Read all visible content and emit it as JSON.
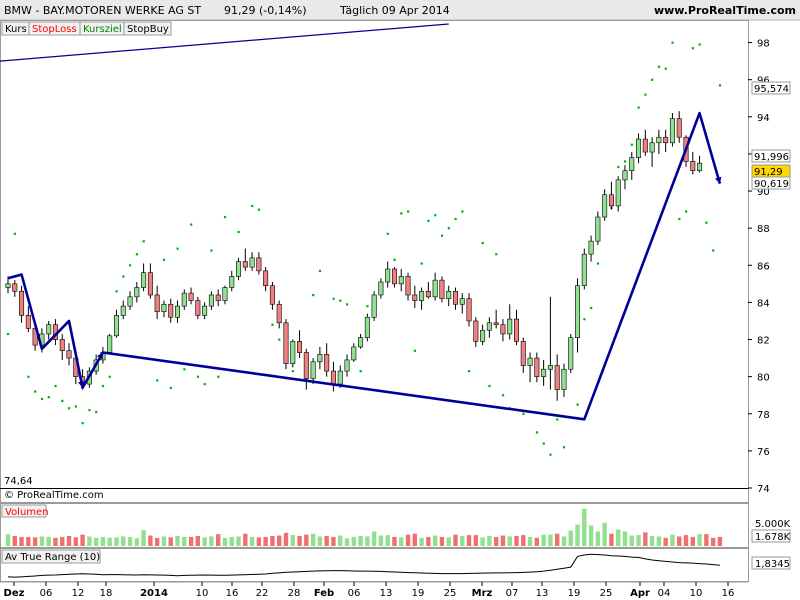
{
  "header": {
    "symbol": "BMW - BAY.MOTOREN WERKE AG ST",
    "quote": "91,29 (-0,14%)",
    "period": "Täglich  09 Apr 2014",
    "site": "www.ProRealTime.com"
  },
  "tabs": [
    {
      "label": "Kurs",
      "color": "#000000"
    },
    {
      "label": "StopLoss",
      "color": "#ff0000"
    },
    {
      "label": "Kursziel",
      "color": "#008000"
    },
    {
      "label": "StopBuy",
      "color": "#000000"
    }
  ],
  "copyright": "© ProRealTime.com",
  "colors": {
    "up": "#8fe08f",
    "down": "#f08080",
    "stop_dots": "#00b000",
    "trend_line": "#000099",
    "volume_up": "#90e090",
    "volume_down": "#f07070",
    "atr_line": "#000000"
  },
  "chart_data": {
    "type": "candlestick",
    "title": "BMW - BAY.MOTOREN WERKE AG ST",
    "ylim": [
      74,
      99
    ],
    "yticks": [
      "98",
      "96",
      "94",
      "92",
      "90",
      "88",
      "86",
      "84",
      "82",
      "80",
      "78",
      "76",
      "74"
    ],
    "min_label": "74,64",
    "price_labels": {
      "last": "91,29",
      "target": "95,574",
      "upper": "91,996",
      "lower": "90,619"
    },
    "x_labels": [
      "Dez",
      "06",
      "12",
      "18",
      "2014",
      "10",
      "16",
      "22",
      "28",
      "Feb",
      "06",
      "13",
      "19",
      "25",
      "Mrz",
      "07",
      "13",
      "19",
      "25",
      "Apr",
      "04",
      "10",
      "16"
    ],
    "x_label_bold": [
      "Dez",
      "2014",
      "Feb",
      "Mrz",
      "Apr"
    ],
    "candles": [
      [
        84.8,
        85.4,
        84.5,
        85.0
      ],
      [
        85.0,
        85.2,
        84.3,
        84.6
      ],
      [
        84.6,
        84.9,
        82.9,
        83.3
      ],
      [
        83.3,
        83.8,
        82.4,
        82.6
      ],
      [
        82.6,
        82.8,
        81.4,
        81.7
      ],
      [
        81.7,
        82.6,
        81.3,
        82.3
      ],
      [
        82.3,
        83.0,
        82.0,
        82.8
      ],
      [
        82.8,
        83.1,
        81.7,
        82.0
      ],
      [
        82.0,
        82.3,
        80.9,
        81.4
      ],
      [
        81.4,
        81.8,
        80.6,
        81.0
      ],
      [
        81.0,
        81.2,
        79.6,
        80.0
      ],
      [
        80.0,
        80.4,
        79.3,
        79.6
      ],
      [
        79.6,
        80.5,
        79.4,
        80.3
      ],
      [
        80.3,
        81.2,
        80.1,
        80.9
      ],
      [
        80.9,
        81.6,
        80.7,
        81.3
      ],
      [
        81.3,
        82.3,
        81.2,
        82.2
      ],
      [
        82.2,
        83.6,
        82.1,
        83.3
      ],
      [
        83.3,
        84.1,
        83.1,
        83.8
      ],
      [
        83.8,
        84.6,
        83.6,
        84.3
      ],
      [
        84.3,
        85.1,
        84.0,
        84.8
      ],
      [
        84.8,
        86.1,
        84.6,
        85.6
      ],
      [
        85.6,
        86.1,
        84.2,
        84.4
      ],
      [
        84.4,
        84.9,
        83.1,
        83.5
      ],
      [
        83.5,
        84.1,
        83.2,
        83.9
      ],
      [
        83.9,
        84.2,
        82.9,
        83.2
      ],
      [
        83.2,
        84.1,
        82.9,
        83.8
      ],
      [
        83.8,
        84.7,
        83.6,
        84.5
      ],
      [
        84.5,
        84.8,
        83.9,
        84.1
      ],
      [
        84.1,
        84.3,
        83.1,
        83.3
      ],
      [
        83.3,
        84.0,
        83.1,
        83.8
      ],
      [
        83.8,
        84.6,
        83.6,
        84.4
      ],
      [
        84.4,
        84.7,
        83.8,
        84.1
      ],
      [
        84.1,
        84.9,
        83.9,
        84.8
      ],
      [
        84.8,
        85.7,
        84.6,
        85.4
      ],
      [
        85.4,
        86.4,
        85.2,
        86.2
      ],
      [
        86.2,
        86.9,
        85.7,
        85.9
      ],
      [
        85.9,
        86.7,
        85.7,
        86.4
      ],
      [
        86.4,
        86.7,
        85.5,
        85.7
      ],
      [
        85.7,
        85.9,
        84.6,
        84.9
      ],
      [
        84.9,
        85.1,
        83.6,
        83.9
      ],
      [
        83.9,
        84.1,
        82.6,
        82.9
      ],
      [
        82.9,
        83.1,
        80.4,
        80.7
      ],
      [
        80.7,
        82.0,
        80.5,
        81.9
      ],
      [
        81.9,
        82.5,
        81.0,
        81.3
      ],
      [
        81.3,
        81.5,
        79.3,
        79.9
      ],
      [
        79.9,
        81.0,
        79.6,
        80.8
      ],
      [
        80.8,
        81.6,
        80.4,
        81.2
      ],
      [
        81.2,
        81.8,
        80.0,
        80.3
      ],
      [
        80.3,
        80.8,
        79.2,
        79.6
      ],
      [
        79.6,
        80.6,
        79.4,
        80.3
      ],
      [
        80.3,
        81.2,
        80.0,
        80.9
      ],
      [
        80.9,
        81.8,
        80.8,
        81.6
      ],
      [
        81.6,
        82.3,
        81.5,
        82.1
      ],
      [
        82.1,
        83.4,
        81.9,
        83.2
      ],
      [
        83.2,
        84.6,
        83.0,
        84.4
      ],
      [
        84.4,
        85.3,
        84.2,
        85.1
      ],
      [
        85.1,
        86.2,
        84.8,
        85.8
      ],
      [
        85.8,
        85.9,
        84.8,
        85.0
      ],
      [
        85.0,
        85.8,
        84.6,
        85.4
      ],
      [
        85.4,
        85.6,
        84.1,
        84.4
      ],
      [
        84.4,
        84.9,
        83.7,
        84.1
      ],
      [
        84.1,
        84.8,
        83.6,
        84.6
      ],
      [
        84.6,
        85.1,
        84.2,
        84.3
      ],
      [
        84.3,
        85.6,
        84.1,
        85.2
      ],
      [
        85.2,
        85.4,
        84.0,
        84.2
      ],
      [
        84.2,
        84.9,
        83.8,
        84.6
      ],
      [
        84.6,
        84.8,
        83.6,
        83.9
      ],
      [
        83.9,
        84.5,
        83.4,
        84.2
      ],
      [
        84.2,
        84.5,
        82.7,
        83.0
      ],
      [
        83.0,
        83.2,
        81.6,
        81.9
      ],
      [
        81.9,
        82.8,
        81.7,
        82.5
      ],
      [
        82.5,
        83.2,
        82.1,
        82.9
      ],
      [
        82.9,
        83.6,
        82.6,
        82.8
      ],
      [
        82.8,
        83.1,
        81.9,
        82.3
      ],
      [
        82.3,
        83.9,
        82.0,
        83.1
      ],
      [
        83.1,
        83.6,
        81.7,
        81.9
      ],
      [
        81.9,
        82.1,
        80.2,
        80.6
      ],
      [
        80.6,
        81.3,
        79.7,
        81.0
      ],
      [
        81.0,
        81.3,
        79.7,
        80.0
      ],
      [
        80.0,
        80.9,
        79.5,
        80.4
      ],
      [
        80.4,
        84.3,
        79.3,
        80.6
      ],
      [
        80.6,
        81.2,
        78.7,
        79.3
      ],
      [
        79.3,
        80.7,
        78.9,
        80.4
      ],
      [
        80.4,
        82.3,
        80.2,
        82.1
      ],
      [
        82.1,
        85.3,
        81.3,
        84.9
      ],
      [
        84.9,
        86.9,
        84.7,
        86.6
      ],
      [
        86.6,
        87.6,
        86.2,
        87.3
      ],
      [
        87.3,
        88.9,
        87.1,
        88.6
      ],
      [
        88.6,
        90.1,
        88.4,
        89.8
      ],
      [
        89.8,
        90.5,
        89.0,
        89.2
      ],
      [
        89.2,
        90.8,
        88.9,
        90.6
      ],
      [
        90.6,
        91.4,
        90.1,
        91.1
      ],
      [
        91.1,
        92.1,
        90.6,
        91.8
      ],
      [
        91.8,
        93.1,
        91.5,
        92.8
      ],
      [
        92.8,
        93.3,
        91.9,
        92.1
      ],
      [
        92.1,
        92.9,
        91.3,
        92.6
      ],
      [
        92.6,
        93.3,
        92.0,
        92.9
      ],
      [
        92.9,
        93.3,
        92.1,
        92.6
      ],
      [
        92.6,
        94.2,
        92.4,
        93.9
      ],
      [
        93.9,
        94.3,
        92.6,
        92.9
      ],
      [
        92.9,
        93.0,
        91.3,
        91.6
      ],
      [
        91.6,
        92.1,
        90.9,
        91.1
      ],
      [
        91.1,
        91.9,
        91.0,
        91.5
      ]
    ],
    "trend_points": [
      [
        0,
        85.3
      ],
      [
        2,
        85.5
      ],
      [
        5,
        81.5
      ],
      [
        9,
        83.0
      ],
      [
        11,
        79.4
      ],
      [
        14,
        81.3
      ],
      [
        85,
        77.7
      ],
      [
        102,
        94.2
      ],
      [
        105,
        90.4
      ]
    ],
    "top_line": [
      [
        0,
        97.0
      ],
      [
        65,
        99.0
      ]
    ],
    "stop_dots": [
      [
        0,
        82.3
      ],
      [
        1,
        87.7
      ],
      [
        3,
        80.0
      ],
      [
        4,
        79.2
      ],
      [
        5,
        78.8
      ],
      [
        6,
        78.9
      ],
      [
        7,
        79.5
      ],
      [
        8,
        78.7
      ],
      [
        9,
        78.3
      ],
      [
        10,
        78.4
      ],
      [
        11,
        77.5
      ],
      [
        12,
        78.2
      ],
      [
        13,
        78.1
      ],
      [
        14,
        79.5
      ],
      [
        15,
        80.0
      ],
      [
        16,
        84.6
      ],
      [
        17,
        85.4
      ],
      [
        18,
        86.0
      ],
      [
        19,
        86.6
      ],
      [
        20,
        87.3
      ],
      [
        22,
        79.8
      ],
      [
        23,
        86.3
      ],
      [
        24,
        79.4
      ],
      [
        25,
        86.9
      ],
      [
        26,
        80.4
      ],
      [
        27,
        88.2
      ],
      [
        28,
        80.0
      ],
      [
        29,
        79.6
      ],
      [
        30,
        86.8
      ],
      [
        31,
        80.0
      ],
      [
        32,
        88.6
      ],
      [
        34,
        87.8
      ],
      [
        36,
        89.2
      ],
      [
        37,
        89.0
      ],
      [
        39,
        82.8
      ],
      [
        40,
        82.0
      ],
      [
        42,
        80.3
      ],
      [
        44,
        79.9
      ],
      [
        45,
        84.4
      ],
      [
        46,
        85.7
      ],
      [
        48,
        84.2
      ],
      [
        49,
        84.1
      ],
      [
        50,
        83.9
      ],
      [
        51,
        81.1
      ],
      [
        52,
        80.3
      ],
      [
        53,
        83.8
      ],
      [
        56,
        87.7
      ],
      [
        57,
        86.3
      ],
      [
        58,
        88.8
      ],
      [
        59,
        88.9
      ],
      [
        60,
        81.4
      ],
      [
        61,
        86.1
      ],
      [
        62,
        88.4
      ],
      [
        63,
        88.7
      ],
      [
        64,
        87.6
      ],
      [
        65,
        88.0
      ],
      [
        66,
        88.5
      ],
      [
        67,
        88.9
      ],
      [
        68,
        80.3
      ],
      [
        70,
        87.2
      ],
      [
        71,
        79.5
      ],
      [
        72,
        86.6
      ],
      [
        73,
        79.0
      ],
      [
        74,
        78.3
      ],
      [
        76,
        78.0
      ],
      [
        78,
        77.0
      ],
      [
        79,
        76.4
      ],
      [
        80,
        75.8
      ],
      [
        81,
        77.7
      ],
      [
        82,
        76.2
      ],
      [
        84,
        78.5
      ],
      [
        85,
        83.1
      ],
      [
        86,
        83.7
      ],
      [
        87,
        86.1
      ],
      [
        89,
        89.1
      ],
      [
        90,
        91.3
      ],
      [
        91,
        91.6
      ],
      [
        92,
        92.5
      ],
      [
        93,
        94.5
      ],
      [
        94,
        95.2
      ],
      [
        95,
        96.0
      ],
      [
        96,
        96.7
      ],
      [
        97,
        96.6
      ],
      [
        98,
        98.0
      ],
      [
        99,
        88.5
      ],
      [
        100,
        88.9
      ],
      [
        101,
        97.7
      ],
      [
        102,
        97.9
      ],
      [
        103,
        88.3
      ],
      [
        104,
        86.8
      ],
      [
        105,
        95.7
      ]
    ],
    "volume": {
      "label": "Volumen",
      "ticks": [
        "5.000K",
        "1.678K"
      ],
      "values": [
        2.6,
        2.2,
        2.0,
        2.0,
        1.9,
        2.1,
        2.0,
        1.8,
        2.0,
        2.2,
        1.9,
        2.5,
        2.1,
        1.8,
        2.0,
        1.8,
        1.9,
        2.1,
        2.0,
        1.7,
        3.5,
        2.3,
        1.8,
        2.1,
        1.9,
        2.2,
        2.0,
        2.0,
        2.2,
        1.9,
        2.1,
        2.6,
        1.8,
        2.0,
        2.1,
        2.7,
        2.0,
        1.9,
        2.0,
        2.2,
        2.3,
        2.9,
        2.4,
        2.2,
        2.5,
        2.7,
        2.1,
        2.2,
        2.0,
        2.3,
        1.7,
        2.0,
        2.2,
        2.1,
        3.2,
        2.3,
        2.4,
        2.0,
        1.9,
        2.5,
        2.7,
        1.8,
        2.0,
        2.3,
        2.0,
        1.9,
        2.5,
        2.2,
        2.4,
        2.4,
        1.9,
        2.2,
        2.0,
        2.3,
        2.1,
        2.2,
        2.4,
        2.0,
        1.8,
        2.5,
        2.5,
        2.7,
        2.1,
        3.4,
        4.7,
        8.2,
        4.5,
        3.2,
        5.1,
        2.7,
        3.6,
        3.2,
        2.3,
        2.4,
        3.0,
        2.2,
        2.1,
        1.8,
        2.5,
        2.1,
        2.4,
        2.0,
        2.6,
        2.6,
        1.8,
        2.0
      ],
      "ylim": [
        0,
        8.8
      ]
    },
    "atr": {
      "label": "Av True Range (10)",
      "value_label": "1,8345",
      "values": [
        1.02,
        1.0,
        1.02,
        1.05,
        1.08,
        1.12,
        1.14,
        1.15,
        1.18,
        1.2,
        1.22,
        1.24,
        1.22,
        1.2,
        1.17,
        1.18,
        1.18,
        1.17,
        1.16,
        1.15,
        1.17,
        1.16,
        1.15,
        1.14,
        1.12,
        1.1,
        1.12,
        1.13,
        1.14,
        1.15,
        1.14,
        1.13,
        1.13,
        1.14,
        1.16,
        1.17,
        1.19,
        1.2,
        1.22,
        1.27,
        1.3,
        1.34,
        1.36,
        1.38,
        1.4,
        1.42,
        1.44,
        1.45,
        1.46,
        1.46,
        1.45,
        1.43,
        1.42,
        1.42,
        1.41,
        1.4,
        1.38,
        1.36,
        1.34,
        1.32,
        1.31,
        1.29,
        1.27,
        1.26,
        1.25,
        1.25,
        1.25,
        1.25,
        1.26,
        1.27,
        1.28,
        1.29,
        1.3,
        1.3,
        1.31,
        1.32,
        1.33,
        1.35,
        1.38,
        1.42,
        1.48,
        1.55,
        1.62,
        1.7,
        2.45,
        2.55,
        2.6,
        2.58,
        2.55,
        2.5,
        2.48,
        2.45,
        2.4,
        2.38,
        2.28,
        2.2,
        2.15,
        2.1,
        2.06,
        2.02,
        2.0,
        1.98,
        1.95,
        1.92,
        1.88,
        1.8345
      ],
      "ylim": [
        0.8,
        2.9
      ]
    }
  }
}
